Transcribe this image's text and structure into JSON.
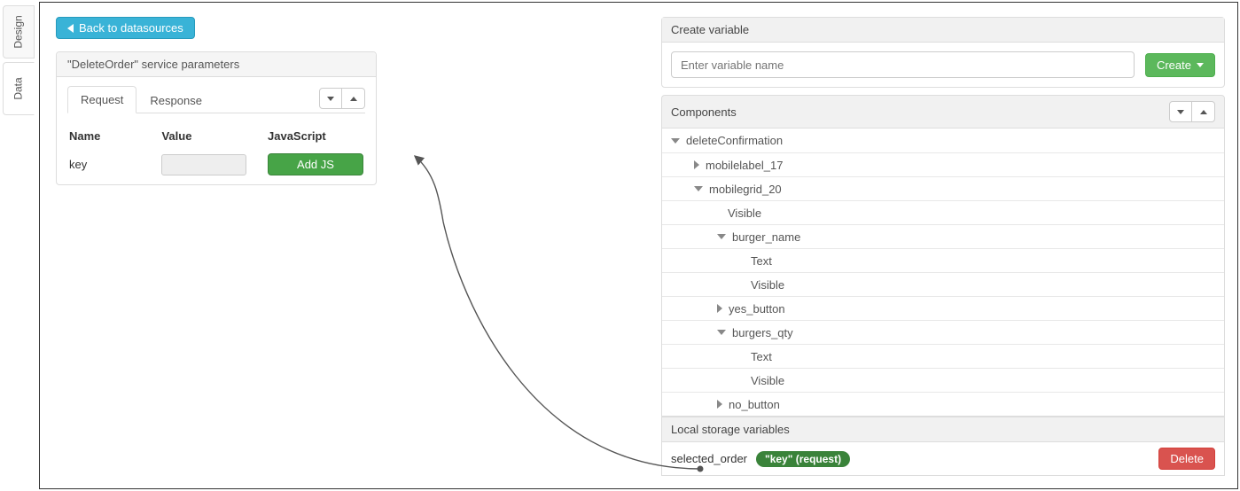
{
  "side_tabs": {
    "design": "Design",
    "data": "Data"
  },
  "back_button": "Back to datasources",
  "params_panel": {
    "title": "\"DeleteOrder\" service parameters",
    "tabs": {
      "request": "Request",
      "response": "Response"
    },
    "cols": {
      "name": "Name",
      "value": "Value",
      "js": "JavaScript"
    },
    "rows": [
      {
        "name": "key",
        "value": "",
        "js_label": "Add JS"
      }
    ]
  },
  "create_var": {
    "title": "Create variable",
    "placeholder": "Enter variable name",
    "button": "Create"
  },
  "components": {
    "title": "Components",
    "tree": {
      "root": "deleteConfirmation",
      "items": [
        {
          "depth": 1,
          "caret": "closed",
          "label": "mobilelabel_17"
        },
        {
          "depth": 1,
          "caret": "open",
          "label": "mobilegrid_20"
        },
        {
          "depth": 2,
          "caret": "none",
          "label": "Visible"
        },
        {
          "depth": 2,
          "caret": "open",
          "label": "burger_name"
        },
        {
          "depth": 3,
          "caret": "none",
          "label": "Text"
        },
        {
          "depth": 3,
          "caret": "none",
          "label": "Visible"
        },
        {
          "depth": 2,
          "caret": "closed",
          "label": "yes_button"
        },
        {
          "depth": 2,
          "caret": "open",
          "label": "burgers_qty"
        },
        {
          "depth": 3,
          "caret": "none",
          "label": "Text"
        },
        {
          "depth": 3,
          "caret": "none",
          "label": "Visible"
        },
        {
          "depth": 2,
          "caret": "closed",
          "label": "no_button"
        }
      ]
    }
  },
  "local_storage": {
    "title": "Local storage variables",
    "var_name": "selected_order",
    "pill": "\"key\" (request)",
    "delete": "Delete"
  }
}
